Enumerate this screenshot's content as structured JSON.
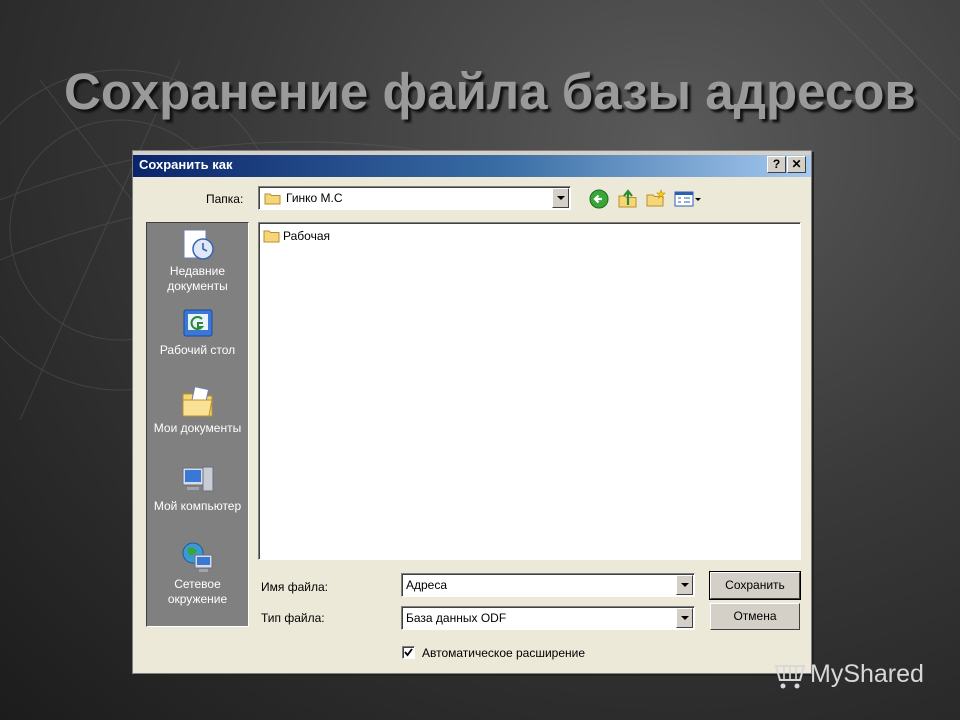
{
  "slide": {
    "title": "Сохранение файла базы адресов"
  },
  "dialog": {
    "title": "Сохранить как",
    "help_label": "?",
    "close_label": "✕",
    "folder_label": "Папка:",
    "folder_value": "Гинко М.С",
    "places": [
      {
        "label": "Недавние документы"
      },
      {
        "label": "Рабочий стол"
      },
      {
        "label": "Мои документы"
      },
      {
        "label": "Мой компьютер"
      },
      {
        "label": "Сетевое окружение"
      }
    ],
    "files": [
      {
        "name": "Рабочая"
      }
    ],
    "filename_label": "Имя файла:",
    "filename_value": "Адреса",
    "filetype_label": "Тип файла:",
    "filetype_value": "База данных ODF",
    "save_label": "Сохранить",
    "cancel_label": "Отмена",
    "auto_ext_label": "Автоматическое расширение",
    "auto_ext_checked": true,
    "toolbar_icons": [
      "back-icon",
      "up-folder-icon",
      "new-folder-icon",
      "view-menu-icon"
    ]
  },
  "watermark": {
    "text": "MyShared"
  },
  "colors": {
    "titlebar_start": "#0a246a",
    "titlebar_end": "#a6caf0",
    "dialog_bg": "#ece9d8"
  }
}
